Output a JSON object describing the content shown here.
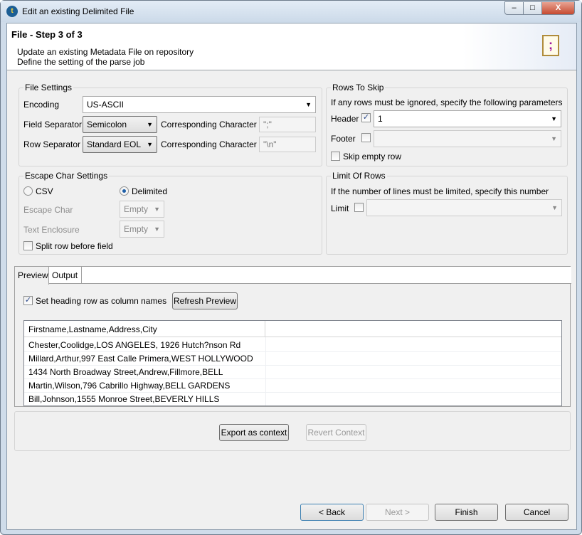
{
  "window": {
    "title": "Edit an existing Delimited File",
    "minimize": "–",
    "maximize": "□",
    "close": "X"
  },
  "header": {
    "title": "File - Step 3 of 3",
    "line1": "Update an existing Metadata File on repository",
    "line2": "Define the setting of the parse job"
  },
  "file_settings": {
    "title": "File Settings",
    "encoding_label": "Encoding",
    "encoding": "US-ASCII",
    "field_sep_label": "Field Separator",
    "field_sep": "Semicolon",
    "corr_label": "Corresponding Character",
    "field_char": "\";\"",
    "row_sep_label": "Row Separator",
    "row_sep": "Standard EOL",
    "row_char": "\"\\n\""
  },
  "rows_to_skip": {
    "title": "Rows To Skip",
    "desc": "If any rows must be ignored, specify the following parameters",
    "header_label": "Header",
    "header_checked": true,
    "header_value": "1",
    "footer_label": "Footer",
    "skip_empty": "Skip empty row"
  },
  "escape": {
    "title": "Escape Char Settings",
    "csv": "CSV",
    "delimited": "Delimited",
    "escape_label": "Escape Char",
    "escape_value": "Empty",
    "enclosure_label": "Text Enclosure",
    "enclosure_value": "Empty",
    "split_row": "Split row before field"
  },
  "limit": {
    "title": "Limit Of Rows",
    "desc": "If the number of lines must be limited, specify this number",
    "limit_label": "Limit"
  },
  "tabs": [
    "Preview",
    "Output"
  ],
  "preview": {
    "heading_checkbox": "Set heading row as column names",
    "refresh": "Refresh Preview",
    "column": "Firstname,Lastname,Address,City",
    "rows": [
      "Chester,Coolidge,LOS ANGELES, 1926 Hutch?nson Rd",
      "Millard,Arthur,997 East Calle Primera,WEST HOLLYWOOD",
      "1434 North Broadway Street,Andrew,Fillmore,BELL",
      "Martin,Wilson,796 Cabrillo Highway,BELL GARDENS",
      "Bill,Johnson,1555 Monroe Street,BEVERLY HILLS"
    ]
  },
  "context": {
    "export": "Export as context",
    "revert": "Revert Context"
  },
  "footer": {
    "back": "< Back",
    "next": "Next >",
    "finish": "Finish",
    "cancel": "Cancel"
  }
}
